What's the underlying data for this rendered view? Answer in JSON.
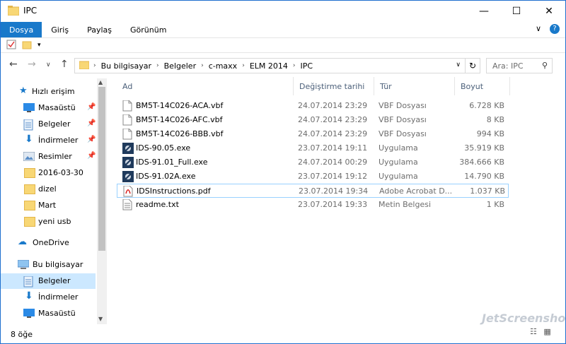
{
  "window": {
    "title": "IPC",
    "minimize": "—",
    "maximize": "☐",
    "close": "✕"
  },
  "ribbon": {
    "tabs": [
      "Dosya",
      "Giriş",
      "Paylaş",
      "Görünüm"
    ],
    "expand": "∨",
    "help": "?"
  },
  "address": {
    "crumbs": [
      "Bu bilgisayar",
      "Belgeler",
      "c-maxx",
      "ELM 2014",
      "IPC"
    ],
    "search_placeholder": "Ara: IPC"
  },
  "sidebar": {
    "items": [
      {
        "label": "Hızlı erişim",
        "icon": "star-icon",
        "pinned": false
      },
      {
        "label": "Masaüstü",
        "icon": "desktop-icon",
        "pinned": true
      },
      {
        "label": "Belgeler",
        "icon": "documents-icon",
        "pinned": true
      },
      {
        "label": "İndirmeler",
        "icon": "downloads-icon",
        "pinned": true
      },
      {
        "label": "Resimler",
        "icon": "pictures-icon",
        "pinned": true
      },
      {
        "label": "2016-03-30",
        "icon": "folder-icon",
        "pinned": false
      },
      {
        "label": "dizel",
        "icon": "folder-icon",
        "pinned": false
      },
      {
        "label": "Mart",
        "icon": "folder-icon",
        "pinned": false
      },
      {
        "label": "yeni usb",
        "icon": "folder-icon",
        "pinned": false
      },
      {
        "label": "OneDrive",
        "icon": "cloud-icon",
        "pinned": false
      },
      {
        "label": "Bu bilgisayar",
        "icon": "computer-icon",
        "pinned": false
      },
      {
        "label": "Belgeler",
        "icon": "documents-icon",
        "pinned": false
      },
      {
        "label": "İndirmeler",
        "icon": "downloads-icon",
        "pinned": false
      },
      {
        "label": "Masaüstü",
        "icon": "desktop-icon",
        "pinned": false
      }
    ]
  },
  "columns": [
    "Ad",
    "Değiştirme tarihi",
    "Tür",
    "Boyut"
  ],
  "files": [
    {
      "name": "BM5T-14C026-ACA.vbf",
      "date": "24.07.2014 23:29",
      "type": "VBF Dosyası",
      "size": "6.728 KB",
      "icon": "file-icon"
    },
    {
      "name": "BM5T-14C026-AFC.vbf",
      "date": "24.07.2014 23:29",
      "type": "VBF Dosyası",
      "size": "8 KB",
      "icon": "file-icon"
    },
    {
      "name": "BM5T-14C026-BBB.vbf",
      "date": "24.07.2014 23:29",
      "type": "VBF Dosyası",
      "size": "994 KB",
      "icon": "file-icon"
    },
    {
      "name": "IDS-90.05.exe",
      "date": "23.07.2014 19:11",
      "type": "Uygulama",
      "size": "35.919 KB",
      "icon": "exe-icon"
    },
    {
      "name": "IDS-91.01_Full.exe",
      "date": "24.07.2014 00:29",
      "type": "Uygulama",
      "size": "384.666 KB",
      "icon": "exe-icon"
    },
    {
      "name": "IDS-91.02A.exe",
      "date": "23.07.2014 19:12",
      "type": "Uygulama",
      "size": "14.790 KB",
      "icon": "exe-icon"
    },
    {
      "name": "IDSInstructions.pdf",
      "date": "23.07.2014 19:34",
      "type": "Adobe Acrobat D...",
      "size": "1.037 KB",
      "icon": "pdf-icon"
    },
    {
      "name": "readme.txt",
      "date": "23.07.2014 19:33",
      "type": "Metin Belgesi",
      "size": "1 KB",
      "icon": "text-file-icon"
    }
  ],
  "status": {
    "count": "8 öğe"
  },
  "watermark": "JetScreenshot"
}
